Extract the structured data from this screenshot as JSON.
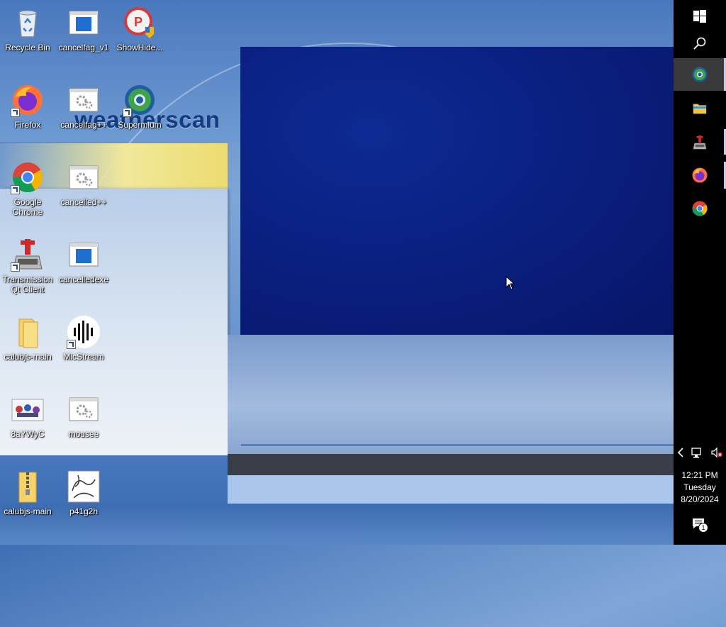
{
  "wallpaper": {
    "brand_text": "weatherscan"
  },
  "desktop": {
    "icons": [
      {
        "id": "recycle-bin",
        "label": "Recycle Bin",
        "icon": "recycle-bin-icon"
      },
      {
        "id": "cancelfag-v1",
        "label": "cancelfag_v1",
        "icon": "window-app-icon"
      },
      {
        "id": "showhide",
        "label": "ShowHide...",
        "icon": "showhide-icon"
      },
      {
        "id": "firefox",
        "label": "Firefox",
        "icon": "firefox-icon"
      },
      {
        "id": "cancelfag-pp",
        "label": "cancelfag++",
        "icon": "settings-file-icon"
      },
      {
        "id": "supermium",
        "label": "Supermium",
        "icon": "supermium-icon"
      },
      {
        "id": "google-chrome",
        "label": "Google Chrome",
        "icon": "chrome-icon"
      },
      {
        "id": "cancelled-pp",
        "label": "cancelled++",
        "icon": "settings-file-icon"
      },
      {
        "id": "transmission",
        "label": "Transmission Qt Client",
        "icon": "transmission-icon"
      },
      {
        "id": "cancelledexe",
        "label": "cancelledexe",
        "icon": "window-app-icon"
      },
      {
        "id": "calubjs-main-folder",
        "label": "calubjs-main",
        "icon": "folder-icon"
      },
      {
        "id": "micstream",
        "label": "MicStream",
        "icon": "micstream-icon"
      },
      {
        "id": "8aywyc",
        "label": "8aYWyC",
        "icon": "image-thumbnail-icon"
      },
      {
        "id": "mousee",
        "label": "mousee",
        "icon": "settings-file-icon"
      },
      {
        "id": "calubjs-main-zip",
        "label": "calubjs-main",
        "icon": "zip-folder-icon"
      },
      {
        "id": "p41g2h",
        "label": "p41g2h",
        "icon": "sketch-image-icon"
      }
    ]
  },
  "taskbar": {
    "start": "windows-start-icon",
    "search": "search-icon",
    "pinned": [
      {
        "name": "supermium",
        "icon": "supermium-icon",
        "active": true
      },
      {
        "name": "file-explorer",
        "icon": "folder-icon",
        "active": false
      },
      {
        "name": "transmission",
        "icon": "transmission-icon",
        "active": false
      },
      {
        "name": "firefox",
        "icon": "firefox-icon",
        "active": false
      },
      {
        "name": "chrome",
        "icon": "chrome-icon",
        "active": false
      }
    ],
    "tray": {
      "chevron": "chevron-left-icon",
      "network": "network-icon",
      "volume": "volume-muted-icon"
    },
    "clock": {
      "time": "12:21 PM",
      "day": "Tuesday",
      "date": "8/20/2024"
    },
    "notifications": {
      "icon": "action-center-icon",
      "count": "1"
    }
  }
}
